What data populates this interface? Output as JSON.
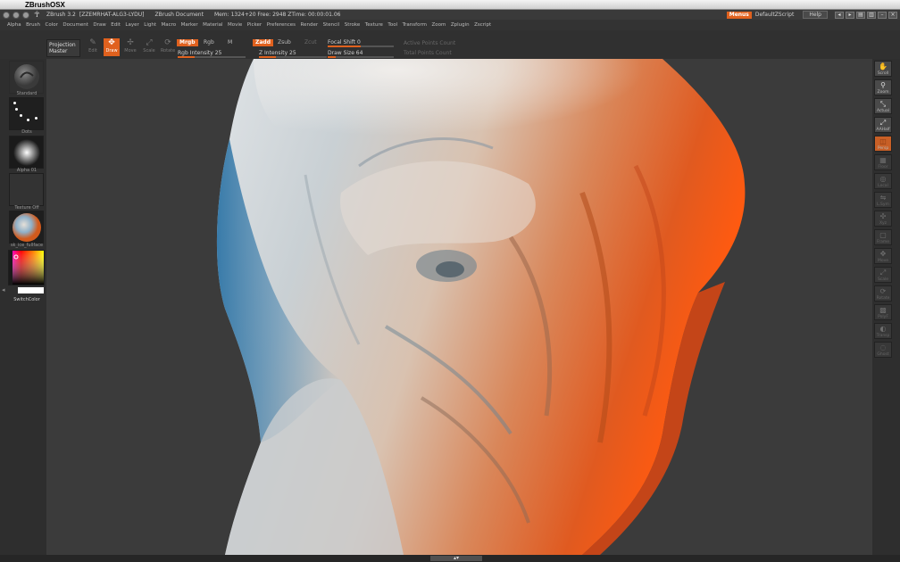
{
  "mac_menubar": {
    "app_name": "ZBrushOSX"
  },
  "titlebar": {
    "version": "ZBrush 3.2",
    "serial": "[ZZEMRHAT-ALG3-LYDU]",
    "document": "ZBrush Document",
    "stats": "Mem: 1324+20  Free: 2948  ZTime: 00:00:01.06",
    "menus_label": "Menus",
    "script_label": "DefaultZScript",
    "help_label": "Help"
  },
  "menu": [
    "Alpha",
    "Brush",
    "Color",
    "Document",
    "Draw",
    "Edit",
    "Layer",
    "Light",
    "Macro",
    "Marker",
    "Material",
    "Movie",
    "Picker",
    "Preferences",
    "Render",
    "Stencil",
    "Stroke",
    "Texture",
    "Tool",
    "Transform",
    "Zoom",
    "Zplugin",
    "Zscript"
  ],
  "toolbar": {
    "projection_line1": "Projection",
    "projection_line2": "Master",
    "tools": [
      {
        "label": "Edit",
        "glyph": "✎",
        "active": false
      },
      {
        "label": "Draw",
        "glyph": "✥",
        "active": true
      },
      {
        "label": "Move",
        "glyph": "✢",
        "active": false
      },
      {
        "label": "Scale",
        "glyph": "⤢",
        "active": false
      },
      {
        "label": "Rotate",
        "glyph": "⟳",
        "active": false
      }
    ],
    "mrgb": "Mrgb",
    "rgb": "Rgb",
    "m": "M",
    "zadd": "Zadd",
    "zsub": "Zsub",
    "zcut": "Zcut",
    "rgb_intensity": {
      "label": "Rgb Intensity 25",
      "value": 25
    },
    "z_intensity": {
      "label": "Z Intensity 25",
      "value": 25
    },
    "focal_shift": {
      "label": "Focal Shift 0",
      "value": 0
    },
    "draw_size": {
      "label": "Draw Size 64",
      "value": 64
    },
    "active_points": "Active Points Count",
    "total_points": "Total Points Count"
  },
  "left_shelf": {
    "brush_label": "Standard",
    "stroke_label": "Dots",
    "alpha_label": "Alpha 01",
    "texture_label": "Texture Off",
    "material_label": "sk_ice_fullface",
    "switch_color": "SwitchColor"
  },
  "right_shelf": [
    "Scroll",
    "Zoom",
    "Actual",
    "AAHalf",
    "Persp",
    "Floor",
    "Local",
    "L.Sym",
    "Xyz",
    "Frame",
    "Move",
    "Scale",
    "Rotate",
    "PolyF",
    "Transp",
    "Ghost"
  ],
  "colors": {
    "accent": "#e0611e",
    "ui_bg": "#2e2e2e",
    "canvas_bg": "#3b3b3b"
  }
}
